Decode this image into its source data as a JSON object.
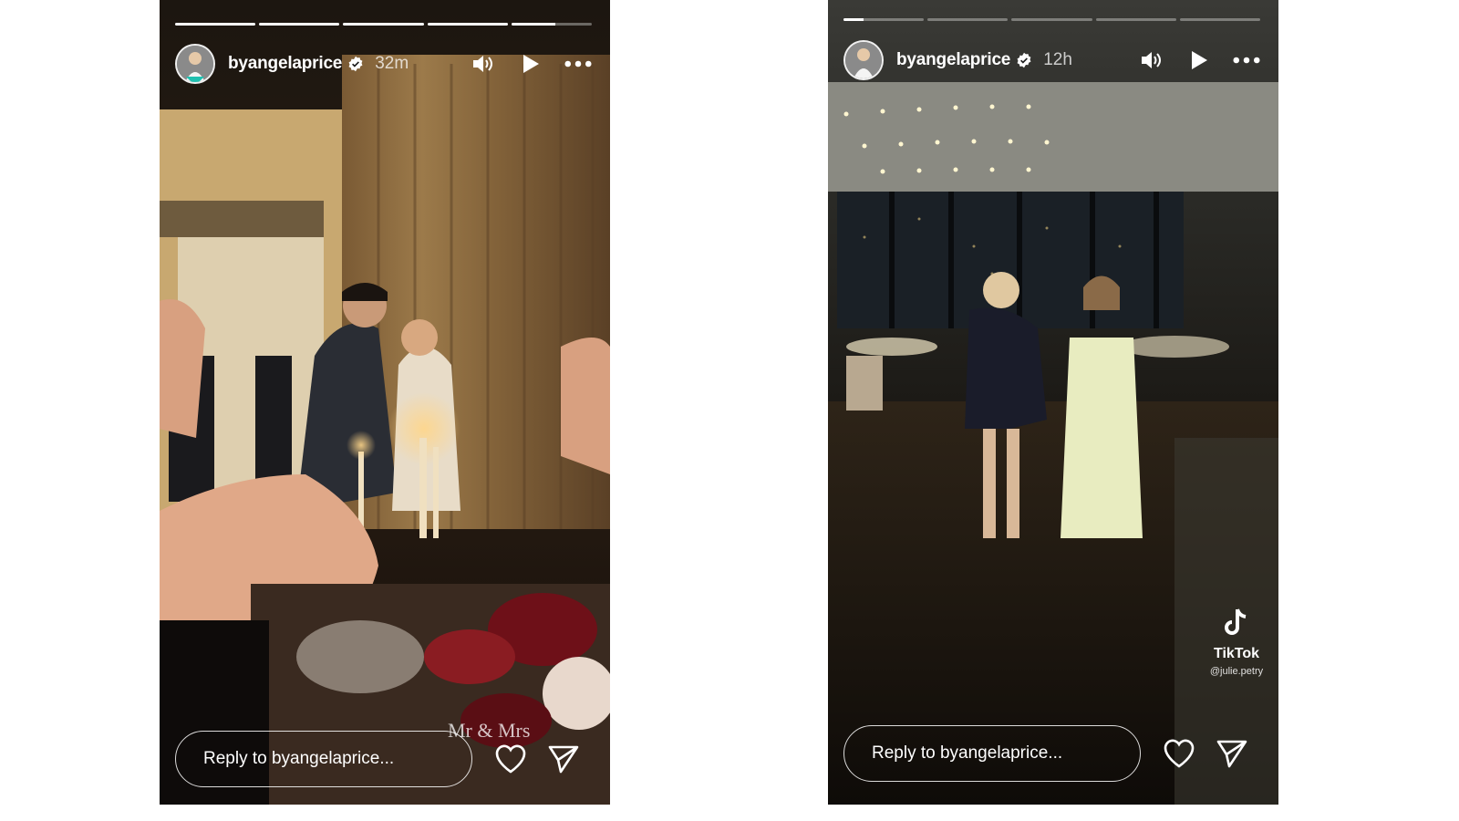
{
  "stories": [
    {
      "username": "byangelaprice",
      "time_ago": "32m",
      "reply_placeholder": "Reply to byangelaprice...",
      "caption": "Mr & Mrs",
      "progress": [
        1,
        1,
        1,
        1,
        0.55
      ]
    },
    {
      "username": "byangelaprice",
      "time_ago": "12h",
      "reply_placeholder": "Reply to byangelaprice...",
      "watermark": {
        "brand": "TikTok",
        "handle": "@julie.petry"
      },
      "progress": [
        0.25,
        0,
        0,
        0,
        0
      ]
    }
  ],
  "icons": {
    "verified": "verified-badge-icon",
    "mute": "speaker-icon",
    "play": "play-icon",
    "more": "more-dots-icon",
    "like": "heart-icon",
    "share": "send-icon"
  },
  "colors": {
    "text": "#ffffff",
    "verified_badge": "#ffffff",
    "page_background": "#ffffff"
  }
}
